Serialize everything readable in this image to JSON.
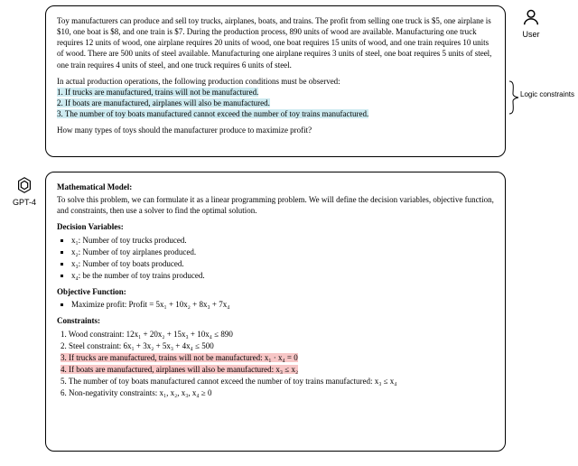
{
  "user": {
    "label": "User",
    "p1": "Toy manufacturers can produce and sell toy trucks, airplanes, boats, and trains. The profit from selling one truck is $5, one airplane is $10, one boat is $8, and one train is $7. During the production process, 890 units of wood are available. Manufacturing one truck requires 12 units of wood, one airplane requires 20 units of wood, one boat requires 15 units of wood, and one train requires 10 units of wood. There are 500 units of steel available. Manufacturing one airplane requires 3 units of steel, one boat requires 5 units of steel, one train requires 4 units of steel, and one truck requires 6 units of steel.",
    "p2_intro": "In actual production operations, the following production conditions must be observed:",
    "c1": "1. If trucks are manufactured, trains will not be manufactured.",
    "c2": "2. If boats are manufactured, airplanes will also be manufactured.",
    "c3": "3. The number of toy boats manufactured cannot exceed the number of toy trains manufactured.",
    "q": "How many types of toys should the manufacturer produce to maximize profit?"
  },
  "brace_label": "Logic constraints",
  "gpt": {
    "label": "GPT-4",
    "model_heading": "Mathematical Model:",
    "model_text": "To solve this problem, we can formulate it as a linear programming problem. We will define the decision variables, objective function, and constraints, then use a solver to find the optimal solution.",
    "dv_heading": "Decision Variables:",
    "dv1": "x₁: Number of toy trucks produced.",
    "dv2": "x₂: Number of toy airplanes produced.",
    "dv3": "x₃: Number of toy boats produced.",
    "dv4": "x₄: be the number of toy trains produced.",
    "obj_heading": "Objective Function:",
    "obj": "Maximize profit: Profit =  5x₁ +  10x₂ +  8x₃ +  7x₄",
    "cons_heading": "Constraints:",
    "cons1": "1. Wood constraint: 12x₁ +  20x₂ +  15x₃ +  10x₄ ≤ 890",
    "cons2": "2. Steel constraint: 6x₁ +  3x₂ +  5x₃ +  4x₄ ≤ 500",
    "cons3": "3. If trucks are manufactured, trains will not be manufactured: x₁ · x₄  =  0",
    "cons4": "4. If boats are manufactured, airplanes will also be manufactured: x₃ ≤ x₂",
    "cons5": "5. The number of toy boats manufactured cannot exceed the number of toy trains manufactured: x₃ ≤ x₄",
    "cons6": "6. Non-negativity constraints: x₁, x₂, x₃, x₄ ≥ 0"
  }
}
